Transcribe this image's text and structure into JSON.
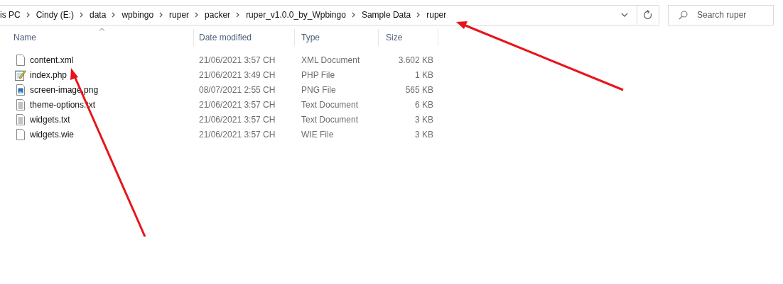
{
  "breadcrumb": [
    "is PC",
    "Cindy (E:)",
    "data",
    "wpbingo",
    "ruper",
    "packer",
    "ruper_v1.0.0_by_Wpbingo",
    "Sample Data",
    "ruper"
  ],
  "search": {
    "placeholder": "Search ruper"
  },
  "columns": [
    "Name",
    "Date modified",
    "Type",
    "Size"
  ],
  "files": [
    {
      "name": "content.xml",
      "date": "21/06/2021 3:57 CH",
      "type": "XML Document",
      "size": "3.602 KB",
      "kind": "blank"
    },
    {
      "name": "index.php",
      "date": "21/06/2021 3:49 CH",
      "type": "PHP File",
      "size": "1 KB",
      "kind": "notepad"
    },
    {
      "name": "screen-image.png",
      "date": "08/07/2021 2:55 CH",
      "type": "PNG File",
      "size": "565 KB",
      "kind": "image"
    },
    {
      "name": "theme-options.txt",
      "date": "21/06/2021 3:57 CH",
      "type": "Text Document",
      "size": "6 KB",
      "kind": "text"
    },
    {
      "name": "widgets.txt",
      "date": "21/06/2021 3:57 CH",
      "type": "Text Document",
      "size": "3 KB",
      "kind": "text"
    },
    {
      "name": "widgets.wie",
      "date": "21/06/2021 3:57 CH",
      "type": "WIE File",
      "size": "3 KB",
      "kind": "blank"
    }
  ]
}
